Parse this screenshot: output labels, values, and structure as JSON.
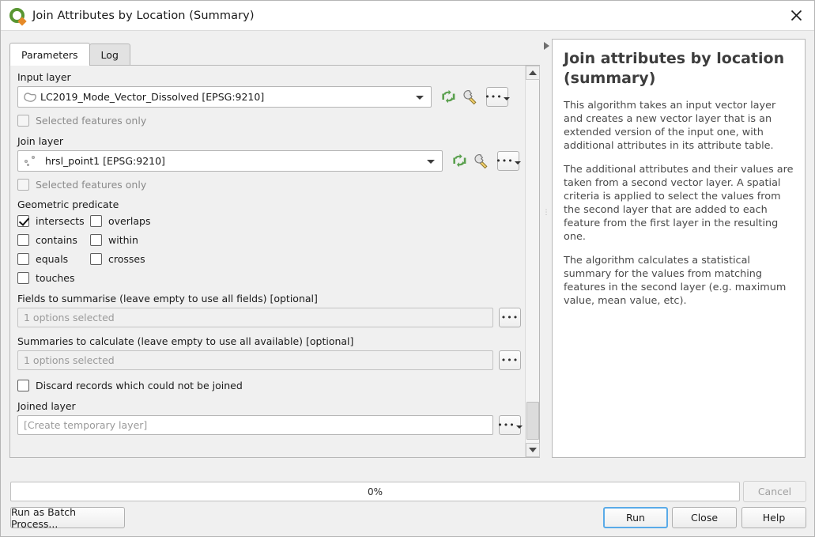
{
  "window": {
    "title": "Join Attributes by Location (Summary)",
    "logo_icon": "qgis-logo-icon",
    "close_icon": "close-icon"
  },
  "tabs": [
    {
      "label": "Parameters",
      "active": true
    },
    {
      "label": "Log",
      "active": false
    }
  ],
  "parameters": {
    "input_layer": {
      "label": "Input layer",
      "value": "LC2019_Mode_Vector_Dissolved [EPSG:9210]",
      "layer_icon": "polygon-layer-icon",
      "refresh_icon": "refresh-icon",
      "wrench_icon": "wrench-icon",
      "more_icon": "ellipsis-dropdown-icon",
      "selected_only_label": "Selected features only",
      "selected_only_checked": false,
      "selected_only_enabled": false
    },
    "join_layer": {
      "label": "Join layer",
      "value": "hrsl_point1 [EPSG:9210]",
      "layer_icon": "point-layer-icon",
      "refresh_icon": "refresh-icon",
      "wrench_icon": "wrench-icon",
      "more_icon": "ellipsis-dropdown-icon",
      "selected_only_label": "Selected features only",
      "selected_only_checked": false,
      "selected_only_enabled": false
    },
    "geometric_predicate": {
      "label": "Geometric predicate",
      "options": [
        {
          "label": "intersects",
          "checked": true
        },
        {
          "label": "overlaps",
          "checked": false
        },
        {
          "label": "contains",
          "checked": false
        },
        {
          "label": "within",
          "checked": false
        },
        {
          "label": "equals",
          "checked": false
        },
        {
          "label": "crosses",
          "checked": false
        },
        {
          "label": "touches",
          "checked": false
        }
      ]
    },
    "fields_to_summarise": {
      "label": "Fields to summarise (leave empty to use all fields) [optional]",
      "value": "1 options selected",
      "button_icon": "ellipsis-icon"
    },
    "summaries_to_calculate": {
      "label": "Summaries to calculate (leave empty to use all available) [optional]",
      "value": "1 options selected",
      "button_icon": "ellipsis-icon"
    },
    "discard_records": {
      "label": "Discard records which could not be joined",
      "checked": false
    },
    "joined_layer": {
      "label": "Joined layer",
      "value": "[Create temporary layer]",
      "button_icon": "ellipsis-dropdown-icon"
    }
  },
  "scrollbar": {
    "up_icon": "scroll-up-arrow-icon",
    "down_icon": "scroll-down-arrow-icon"
  },
  "splitter": {
    "collapse_icon": "collapse-right-arrow-icon",
    "grip_icon": "splitter-grip-icon"
  },
  "help": {
    "title": "Join attributes by location (summary)",
    "paragraphs": [
      "This algorithm takes an input vector layer and creates a new vector layer that is an extended version of the input one, with additional attributes in its attribute table.",
      "The additional attributes and their values are taken from a second vector layer. A spatial criteria is applied to select the values from the second layer that are added to each feature from the first layer in the resulting one.",
      "The algorithm calculates a statistical summary for the values from matching features in the second layer (e.g. maximum value, mean value, etc)."
    ]
  },
  "footer": {
    "progress_text": "0%",
    "progress_percent": 0,
    "cancel_label": "Cancel",
    "cancel_enabled": false,
    "batch_label": "Run as Batch Process...",
    "run_label": "Run",
    "close_label": "Close",
    "help_label": "Help"
  },
  "colors": {
    "accent_blue": "#5aabe8",
    "qgis_green": "#589632",
    "qgis_orange": "#e58a28",
    "panel_bg": "#f0f0f0",
    "field_bg": "#ffffff"
  }
}
